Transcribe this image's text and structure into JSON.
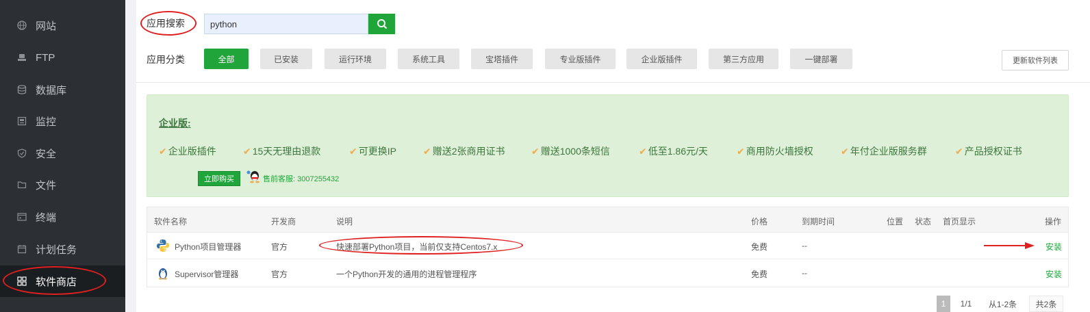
{
  "sidebar": {
    "items": [
      {
        "label": "网站",
        "icon": "globe-icon"
      },
      {
        "label": "FTP",
        "icon": "ftp-icon"
      },
      {
        "label": "数据库",
        "icon": "database-icon"
      },
      {
        "label": "监控",
        "icon": "monitor-icon"
      },
      {
        "label": "安全",
        "icon": "shield-icon"
      },
      {
        "label": "文件",
        "icon": "folder-icon"
      },
      {
        "label": "终端",
        "icon": "terminal-icon"
      },
      {
        "label": "计划任务",
        "icon": "calendar-icon"
      },
      {
        "label": "软件商店",
        "icon": "apps-grid-icon"
      }
    ]
  },
  "search": {
    "label": "应用搜索",
    "value": "python"
  },
  "categories": {
    "label": "应用分类",
    "items": [
      "全部",
      "已安装",
      "运行环境",
      "系统工具",
      "宝塔插件",
      "专业版插件",
      "企业版插件",
      "第三方应用",
      "一键部署"
    ],
    "refresh_label": "更新软件列表"
  },
  "ad": {
    "title": "企业版:",
    "features": [
      "企业版插件",
      "15天无理由退款",
      "可更换IP",
      "赠送2张商用证书",
      "赠送1000条短信",
      "低至1.86元/天",
      "商用防火墙授权",
      "年付企业版服务群",
      "产品授权证书"
    ],
    "buy_label": "立即购买",
    "support": "售前客服: 3007255432"
  },
  "table": {
    "headers": [
      "软件名称",
      "开发商",
      "说明",
      "价格",
      "到期时间",
      "位置",
      "状态",
      "首页显示",
      "操作"
    ],
    "rows": [
      {
        "name": "Python项目管理器",
        "vendor": "官方",
        "desc": "快速部署Python项目，当前仅支持Centos7.x",
        "price": "免费",
        "expire": "--",
        "action": "安装"
      },
      {
        "name": "Supervisor管理器",
        "vendor": "官方",
        "desc": "一个Python开发的通用的进程管理程序",
        "price": "免费",
        "expire": "--",
        "action": "安装"
      }
    ]
  },
  "pagination": {
    "current": "1",
    "pages": "1/1",
    "range": "从1-2条",
    "total": "共2条"
  },
  "colors": {
    "accent": "#20a53a",
    "sidebar": "#2c3034",
    "annotation": "#e02020"
  }
}
